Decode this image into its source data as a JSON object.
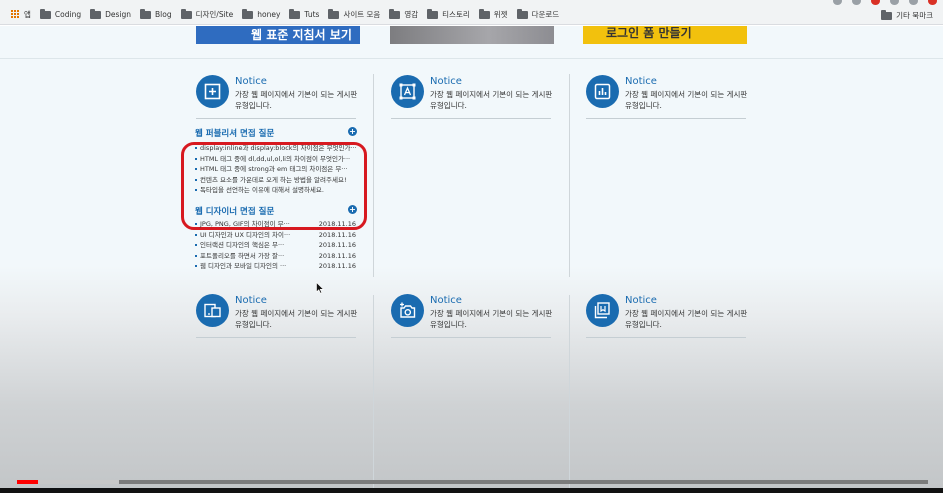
{
  "browser": {
    "apps_label": "앱",
    "bookmarks": [
      "Coding",
      "Design",
      "Blog",
      "디자인/Site",
      "honey",
      "Tuts",
      "사이트 모음",
      "영감",
      "티스토리",
      "위젯",
      "다운로드"
    ],
    "other_bookmarks": "기타 북마크"
  },
  "banners": [
    {
      "text": "웹 표준 지침서 보기"
    },
    {
      "text": ""
    },
    {
      "text": "로그인 폼 만들기"
    }
  ],
  "notices": [
    {
      "title": "Notice",
      "desc": "가장 웹 페이지에서 기본이 되는 게시판 유형입니다.",
      "icon": "plus-square-icon"
    },
    {
      "title": "Notice",
      "desc": "가장 웹 페이지에서 기본이 되는 게시판 유형입니다.",
      "icon": "text-frame-icon"
    },
    {
      "title": "Notice",
      "desc": "가장 웹 페이지에서 기본이 되는 게시판 유형입니다.",
      "icon": "bar-chart-icon"
    },
    {
      "title": "Notice",
      "desc": "가장 웹 페이지에서 기본이 되는 게시판 유형입니다.",
      "icon": "devices-icon"
    },
    {
      "title": "Notice",
      "desc": "가장 웹 페이지에서 기본이 되는 게시판 유형입니다.",
      "icon": "camera-add-icon"
    },
    {
      "title": "Notice",
      "desc": "가장 웹 페이지에서 기본이 되는 게시판 유형입니다.",
      "icon": "layers-icon"
    }
  ],
  "publisher_board": {
    "title": "웹 퍼블리셔 면접 질문",
    "more": "+",
    "items": [
      "display:inline과 display:block의 차이점은 무엇인가···",
      "HTML 태그 중에 dl,dd,ul,ol,li의 차이점이 무엇인가···",
      "HTML 태그 중에 strong과 em 태그의 차이점은 무···",
      "컨텐츠 요소를 가운데로 오게 하는 방법을 알려주세요!",
      "독타입을 선언하는 이유에 대해서 설명하세요."
    ]
  },
  "designer_board": {
    "title": "웹 디자이너 면접 질문",
    "more": "+",
    "items": [
      {
        "text": "JPG, PNG, GIF의 차이점이 무···",
        "date": "2018.11.16"
      },
      {
        "text": "UI 디자인과 UX 디자인의 차이···",
        "date": "2018.11.16"
      },
      {
        "text": "인터랙션 디자인의 핵심은 무···",
        "date": "2018.11.16"
      },
      {
        "text": "포트폴리오를 하면서 가장 잘···",
        "date": "2018.11.16"
      },
      {
        "text": "웹 디자인과 모바일 디자인의 ···",
        "date": "2018.11.16"
      }
    ]
  },
  "colors": {
    "accent": "#1a6bb0",
    "highlight": "#d71920"
  },
  "video": {
    "progress": 0.023,
    "buffered": 0.112
  }
}
